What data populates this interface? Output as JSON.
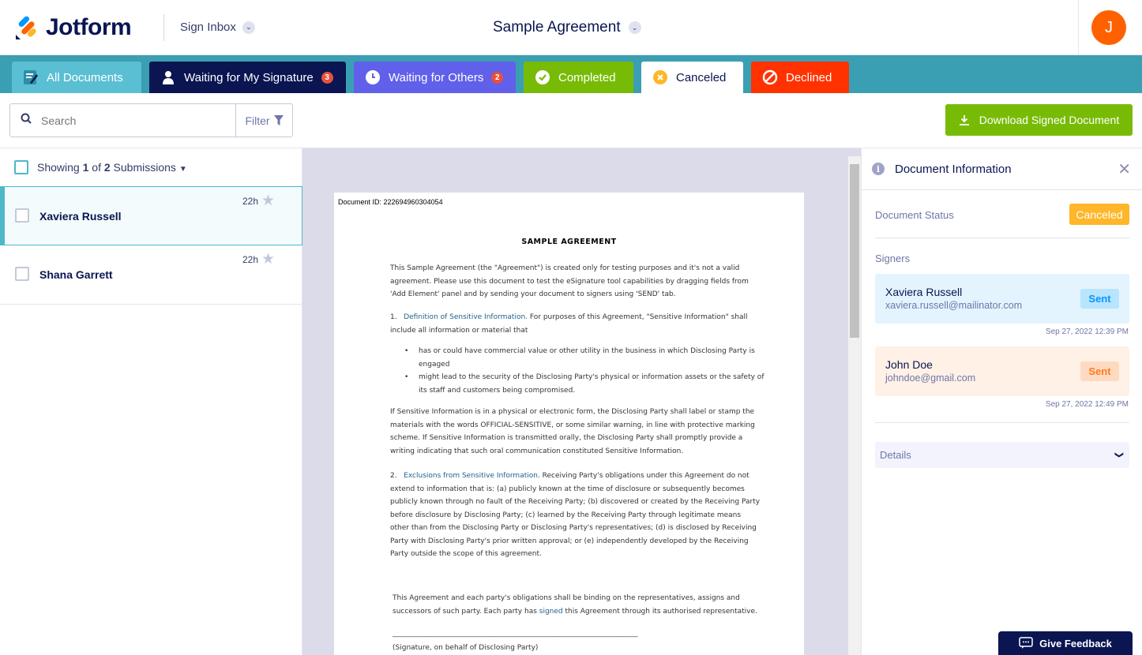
{
  "header": {
    "brand": "Jotform",
    "inbox_label": "Sign Inbox",
    "doc_title": "Sample Agreement",
    "avatar_initial": "J"
  },
  "tabs": [
    {
      "label": "All Documents",
      "color": "#5bbfd3"
    },
    {
      "label": "Waiting for My Signature",
      "badge": "3",
      "color": "#0a1551"
    },
    {
      "label": "Waiting for Others",
      "badge": "2",
      "color": "#6060ea"
    },
    {
      "label": "Completed",
      "color": "#78bb07"
    },
    {
      "label": "Canceled",
      "color": "#ffffff"
    },
    {
      "label": "Declined",
      "color": "#ff3200"
    }
  ],
  "toolbar": {
    "search_placeholder": "Search",
    "filter_label": "Filter",
    "download_label": "Download Signed Document"
  },
  "list": {
    "showing_prefix": "Showing",
    "showing_current": "1",
    "showing_of": "of",
    "showing_total": "2",
    "showing_suffix": "Submissions",
    "items": [
      {
        "name": "Xaviera Russell",
        "time": "22h"
      },
      {
        "name": "Shana Garrett",
        "time": "22h"
      }
    ]
  },
  "document": {
    "id_text": "Document ID: 222694960304054",
    "title": "SAMPLE AGREEMENT",
    "intro": "This Sample Agreement (the \"Agreement\") is created only for testing purposes and it's not a valid agreement. Please use this document to test the eSignature tool capabilities by dragging fields from 'Add Element' panel and by sending your document to signers using 'SEND' tab.",
    "s1_num": "1.",
    "s1_head": "Definition of Sensitive Information.",
    "s1_text": " For purposes of this Agreement, \"Sensitive Information\" shall include all information or material that",
    "bullets": [
      "has or could have commercial value or other utility in the business in which Disclosing Party is engaged",
      "might lead to the security of the Disclosing Party's physical or information assets  or the safety of its staff and customers  being compromised."
    ],
    "p2": "If Sensitive Information is in a physical or electronic form, the Disclosing Party shall label or stamp the materials with the words OFFICIAL-SENSITIVE, or some similar warning, in line with protective marking scheme. If Sensitive Information is transmitted orally, the Disclosing Party shall promptly provide a writing indicating that such oral communication constituted Sensitive Information.",
    "s2_num": "2.",
    "s2_head": "Exclusions from Sensitive Information.",
    "s2_text": " Receiving Party's obligations under this Agreement do not extend to information that is: (a) publicly known at the time of disclosure or subsequently becomes publicly known through no fault of the Receiving Party; (b) discovered or created by the Receiving Party before disclosure by Disclosing Party; (c) learned by the Receiving Party through legitimate means other than from the Disclosing Party or Disclosing Party's representatives; (d) is disclosed by Receiving Party with Disclosing Party's prior written approval; or (e) independently developed by the Receiving Party outside the scope of this agreement.",
    "closing_a": "This Agreement and each party's obligations shall be binding on the representatives, assigns and successors of such party. Each party has ",
    "closing_link": "signed",
    "closing_b": " this Agreement through its authorised representative.",
    "sig_line": "_____________________________________________________________________",
    "sig_caption": "(Signature, on behalf of Disclosing Party)"
  },
  "panel": {
    "title": "Document Information",
    "status_label": "Document Status",
    "status_value": "Canceled",
    "signers_label": "Signers",
    "signers": [
      {
        "name": "Xaviera Russell",
        "email": "xaviera.russell@mailinator.com",
        "status": "Sent",
        "date": "Sep 27, 2022 12:39 PM"
      },
      {
        "name": "John Doe",
        "email": "johndoe@gmail.com",
        "status": "Sent",
        "date": "Sep 27, 2022 12:49 PM"
      }
    ],
    "details_label": "Details"
  },
  "feedback_label": "Give Feedback"
}
